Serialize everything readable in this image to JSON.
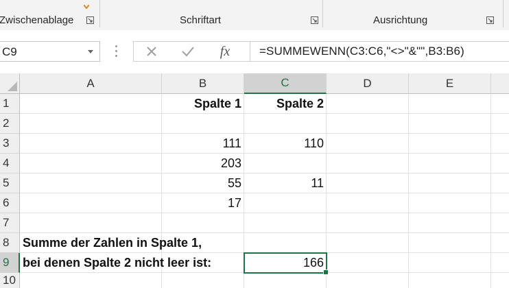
{
  "ribbon": {
    "groups": [
      {
        "label": "Zwischenablage"
      },
      {
        "label": "Schriftart"
      },
      {
        "label": "Ausrichtung"
      }
    ]
  },
  "formula_bar": {
    "name_box": "C9",
    "cancel_icon": "cancel-x-icon",
    "enter_icon": "checkmark-icon",
    "fx_label": "fx",
    "formula": "=SUMMEWENN(C3:C6,\"<>\"&\"\",B3:B6)"
  },
  "sheet": {
    "columns": [
      "A",
      "B",
      "C",
      "D",
      "E"
    ],
    "active_column": "C",
    "rows": [
      "1",
      "2",
      "3",
      "4",
      "5",
      "6",
      "7",
      "8",
      "9",
      "10"
    ],
    "active_row": "9",
    "selected_cell": "C9",
    "accent_color": "#217346",
    "cells": {
      "B1": "Spalte 1",
      "C1": "Spalte 2",
      "B3": "111",
      "C3": "110",
      "B4": "203",
      "B5": "55",
      "C5": "11",
      "B6": "17",
      "A8": "Summe der Zahlen in Spalte 1,",
      "A9": "bei denen Spalte 2 nicht leer ist:",
      "C9": "166"
    }
  }
}
